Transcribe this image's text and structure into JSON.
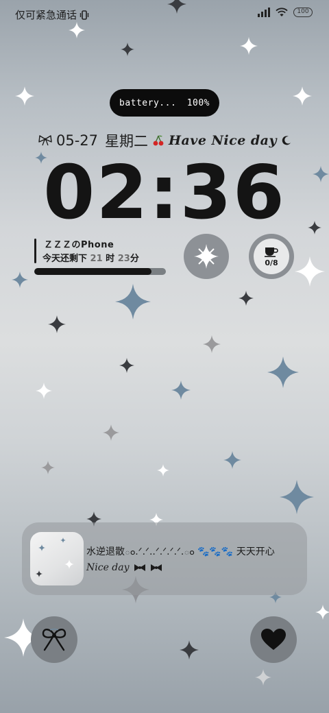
{
  "status_bar": {
    "carrier_text": "仅可紧急通话",
    "battery_level": "100",
    "icons": [
      "vibrate-icon",
      "signal-icon",
      "wifi-icon",
      "battery-icon"
    ]
  },
  "battery_widget": {
    "label": "battery...",
    "value": "100%"
  },
  "date_line": {
    "date": "05-27",
    "weekday": "星期二",
    "greeting": "Have Nice day",
    "icons": [
      "bow-icon",
      "cherry-icon",
      "moon-icon"
    ]
  },
  "clock": {
    "time": "02:36"
  },
  "phone_widget": {
    "name": "ＺＺＺのPhone",
    "remaining_prefix": "今天还剩下",
    "hours": "21",
    "hours_unit": "时",
    "minutes": "23",
    "minutes_unit": "分",
    "progress": 0.89
  },
  "shortcuts": {
    "sparkle_icon": "sparkle-icon",
    "coffee_icon": "coffee-cup-icon",
    "coffee_count": "0/8"
  },
  "music_card": {
    "title": "水逆退散ం.ᐟ.ᐟ..ᐟ.ᐟ.ᐟ.ᐟ.ం 🐾🐾🐾 天天开心",
    "subtitle": "Nice day",
    "icons": [
      "bow-icon",
      "bow-icon"
    ]
  },
  "bottom_buttons": {
    "left_icon": "bow-icon",
    "right_icon": "heart-icon"
  },
  "colors": {
    "accent_dark": "#141414",
    "star_blue": "#6f8aa0",
    "star_white": "#ffffff",
    "star_dark": "#3b3d40"
  }
}
